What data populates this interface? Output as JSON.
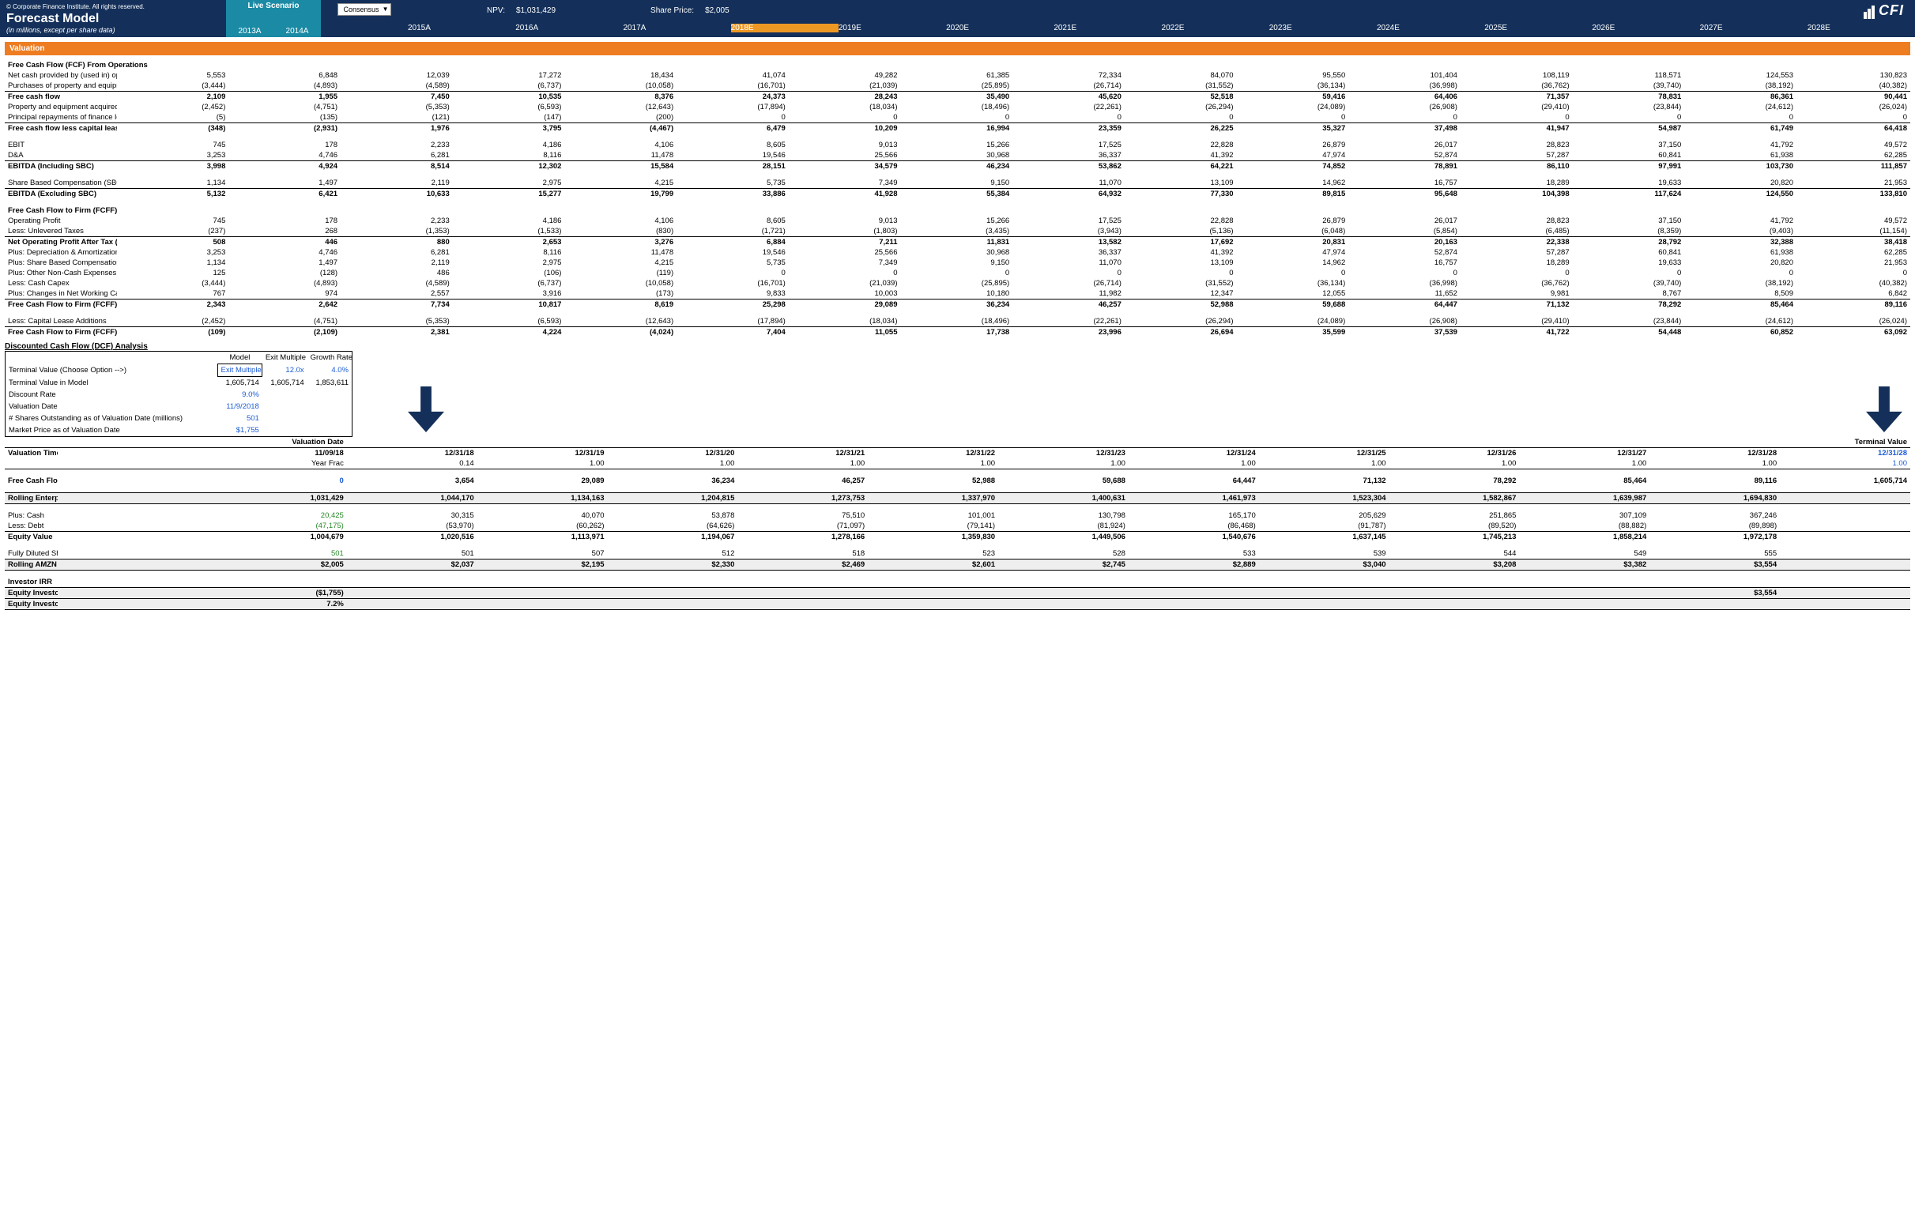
{
  "header": {
    "copyright": "© Corporate Finance Institute. All rights reserved.",
    "title": "Forecast Model",
    "subtitle": "(in millions, except per share data)",
    "scenario_label": "Live Scenario",
    "dropdown": "Consensus",
    "npv_label": "NPV:",
    "npv_value": "$1,031,429",
    "price_label": "Share Price:",
    "price_value": "$2,005",
    "logo": "CFI",
    "years": [
      "2013A",
      "2014A",
      "2015A",
      "2016A",
      "2017A",
      "2018E",
      "2019E",
      "2020E",
      "2021E",
      "2022E",
      "2023E",
      "2024E",
      "2025E",
      "2026E",
      "2027E",
      "2028E"
    ]
  },
  "valuation_bar": "Valuation",
  "fcf_ops": {
    "title": "Free Cash Flow (FCF) From Operations",
    "net_cash": {
      "label": "Net cash provided by (used in) operating activities",
      "v": [
        "5,553",
        "6,848",
        "12,039",
        "17,272",
        "18,434",
        "41,074",
        "49,282",
        "61,385",
        "72,334",
        "84,070",
        "95,550",
        "101,404",
        "108,119",
        "118,571",
        "124,553",
        "130,823"
      ]
    },
    "purchases": {
      "label": "Purchases of property and equipment",
      "v": [
        "(3,444)",
        "(4,893)",
        "(4,589)",
        "(6,737)",
        "(10,058)",
        "(16,701)",
        "(21,039)",
        "(25,895)",
        "(26,714)",
        "(31,552)",
        "(36,134)",
        "(36,998)",
        "(36,762)",
        "(39,740)",
        "(38,192)",
        "(40,382)"
      ]
    },
    "fcf": {
      "label": "Free cash flow",
      "v": [
        "2,109",
        "1,955",
        "7,450",
        "10,535",
        "8,376",
        "24,373",
        "28,243",
        "35,490",
        "45,620",
        "52,518",
        "59,416",
        "64,406",
        "71,357",
        "78,831",
        "86,361",
        "90,441"
      ]
    },
    "ppe_lease": {
      "label": "Property and equipment acquired under capital leases",
      "v": [
        "(2,452)",
        "(4,751)",
        "(5,353)",
        "(6,593)",
        "(12,643)",
        "(17,894)",
        "(18,034)",
        "(18,496)",
        "(22,261)",
        "(26,294)",
        "(24,089)",
        "(26,908)",
        "(29,410)",
        "(23,844)",
        "(24,612)",
        "(26,024)"
      ]
    },
    "principal": {
      "label": "Principal repayments of finance lease obligations",
      "v": [
        "(5)",
        "(135)",
        "(121)",
        "(147)",
        "(200)",
        "0",
        "0",
        "0",
        "0",
        "0",
        "0",
        "0",
        "0",
        "0",
        "0",
        "0"
      ]
    },
    "fcf_less": {
      "label": "Free cash flow less capital leases",
      "v": [
        "(348)",
        "(2,931)",
        "1,976",
        "3,795",
        "(4,467)",
        "6,479",
        "10,209",
        "16,994",
        "23,359",
        "26,225",
        "35,327",
        "37,498",
        "41,947",
        "54,987",
        "61,749",
        "64,418"
      ]
    }
  },
  "ebitda": {
    "ebit": {
      "label": "EBIT",
      "v": [
        "745",
        "178",
        "2,233",
        "4,186",
        "4,106",
        "8,605",
        "9,013",
        "15,266",
        "17,525",
        "22,828",
        "26,879",
        "26,017",
        "28,823",
        "37,150",
        "41,792",
        "49,572"
      ]
    },
    "da": {
      "label": "D&A",
      "v": [
        "3,253",
        "4,746",
        "6,281",
        "8,116",
        "11,478",
        "19,546",
        "25,566",
        "30,968",
        "36,337",
        "41,392",
        "47,974",
        "52,874",
        "57,287",
        "60,841",
        "61,938",
        "62,285"
      ]
    },
    "inc_sbc": {
      "label": "EBITDA (Including SBC)",
      "v": [
        "3,998",
        "4,924",
        "8,514",
        "12,302",
        "15,584",
        "28,151",
        "34,579",
        "46,234",
        "53,862",
        "64,221",
        "74,852",
        "78,891",
        "86,110",
        "97,991",
        "103,730",
        "111,857"
      ]
    },
    "sbc": {
      "label": "Share Based Compensation (SBC)",
      "v": [
        "1,134",
        "1,497",
        "2,119",
        "2,975",
        "4,215",
        "5,735",
        "7,349",
        "9,150",
        "11,070",
        "13,109",
        "14,962",
        "16,757",
        "18,289",
        "19,633",
        "20,820",
        "21,953"
      ]
    },
    "ex_sbc": {
      "label": "EBITDA (Excluding SBC)",
      "v": [
        "5,132",
        "6,421",
        "10,633",
        "15,277",
        "19,799",
        "33,886",
        "41,928",
        "55,384",
        "64,932",
        "77,330",
        "89,815",
        "95,648",
        "104,398",
        "117,624",
        "124,550",
        "133,810"
      ]
    }
  },
  "fcff": {
    "title": "Free Cash Flow to Firm (FCFF)",
    "op_profit": {
      "label": "Operating Profit",
      "v": [
        "745",
        "178",
        "2,233",
        "4,186",
        "4,106",
        "8,605",
        "9,013",
        "15,266",
        "17,525",
        "22,828",
        "26,879",
        "26,017",
        "28,823",
        "37,150",
        "41,792",
        "49,572"
      ]
    },
    "unlev_tax": {
      "label": "  Less: Unlevered Taxes",
      "v": [
        "(237)",
        "268",
        "(1,353)",
        "(1,533)",
        "(830)",
        "(1,721)",
        "(1,803)",
        "(3,435)",
        "(3,943)",
        "(5,136)",
        "(6,048)",
        "(5,854)",
        "(6,485)",
        "(8,359)",
        "(9,403)",
        "(11,154)"
      ]
    },
    "nopat": {
      "label": "Net Operating Profit After Tax (NOPAT)",
      "v": [
        "508",
        "446",
        "880",
        "2,653",
        "3,276",
        "6,884",
        "7,211",
        "11,831",
        "13,582",
        "17,692",
        "20,831",
        "20,163",
        "22,338",
        "28,792",
        "32,388",
        "38,418"
      ]
    },
    "da": {
      "label": "  Plus: Depreciation & Amortization",
      "v": [
        "3,253",
        "4,746",
        "6,281",
        "8,116",
        "11,478",
        "19,546",
        "25,566",
        "30,968",
        "36,337",
        "41,392",
        "47,974",
        "52,874",
        "57,287",
        "60,841",
        "61,938",
        "62,285"
      ]
    },
    "sbc": {
      "label": "  Plus: Share Based Compensation",
      "v": [
        "1,134",
        "1,497",
        "2,119",
        "2,975",
        "4,215",
        "5,735",
        "7,349",
        "9,150",
        "11,070",
        "13,109",
        "14,962",
        "16,757",
        "18,289",
        "19,633",
        "20,820",
        "21,953"
      ]
    },
    "other": {
      "label": "  Plus: Other Non-Cash Expenses",
      "v": [
        "125",
        "(128)",
        "486",
        "(106)",
        "(119)",
        "0",
        "0",
        "0",
        "0",
        "0",
        "0",
        "0",
        "0",
        "0",
        "0",
        "0"
      ]
    },
    "capex": {
      "label": "  Less: Cash Capex",
      "v": [
        "(3,444)",
        "(4,893)",
        "(4,589)",
        "(6,737)",
        "(10,058)",
        "(16,701)",
        "(21,039)",
        "(25,895)",
        "(26,714)",
        "(31,552)",
        "(36,134)",
        "(36,998)",
        "(36,762)",
        "(39,740)",
        "(38,192)",
        "(40,382)"
      ]
    },
    "nwc": {
      "label": "  Plus: Changes in Net Working Capital",
      "v": [
        "767",
        "974",
        "2,557",
        "3,916",
        "(173)",
        "9,833",
        "10,003",
        "10,180",
        "11,982",
        "12,347",
        "12,055",
        "11,652",
        "9,981",
        "8,767",
        "8,509",
        "6,842"
      ]
    },
    "fcff": {
      "label": "Free Cash Flow to Firm (FCFF)",
      "v": [
        "2,343",
        "2,642",
        "7,734",
        "10,817",
        "8,619",
        "25,298",
        "29,089",
        "36,234",
        "46,257",
        "52,988",
        "59,688",
        "64,447",
        "71,132",
        "78,292",
        "85,464",
        "89,116"
      ]
    },
    "cla": {
      "label": "  Less: Capital Lease Additions",
      "v": [
        "(2,452)",
        "(4,751)",
        "(5,353)",
        "(6,593)",
        "(12,643)",
        "(17,894)",
        "(18,034)",
        "(18,496)",
        "(22,261)",
        "(26,294)",
        "(24,089)",
        "(26,908)",
        "(29,410)",
        "(23,844)",
        "(24,612)",
        "(26,024)"
      ]
    },
    "fcff_all": {
      "label": "Free Cash Flow to Firm (FCFF) If All Cash Capex",
      "v": [
        "(109)",
        "(2,109)",
        "2,381",
        "4,224",
        "(4,024)",
        "7,404",
        "11,055",
        "17,738",
        "23,996",
        "26,694",
        "35,599",
        "37,539",
        "41,722",
        "54,448",
        "60,852",
        "63,092"
      ]
    }
  },
  "dcf": {
    "title": "Discounted Cash Flow (DCF) Analysis",
    "hdr": [
      "Model",
      "Exit Multiple",
      "Growth Rate"
    ],
    "tv_choice": {
      "label": "Terminal Value (Choose Option -->)",
      "v": [
        "Exit Multiple",
        "12.0x",
        "4.0%"
      ]
    },
    "tv_model": {
      "label": "Terminal Value in Model",
      "v": [
        "1,605,714",
        "1,605,714",
        "1,853,611"
      ]
    },
    "disc": {
      "label": "Discount Rate",
      "v": "9.0%"
    },
    "date": {
      "label": "Valuation Date",
      "v": "11/9/2018"
    },
    "shares": {
      "label": "# Shares Outstanding as of Valuation Date (millions)",
      "v": "501"
    },
    "price": {
      "label": "Market Price as of Valuation Date",
      "v": "$1,755"
    }
  },
  "timeline": {
    "val_date": "Valuation Date",
    "term_val": "Terminal Value",
    "title": "Valuation Timeline",
    "dates": [
      "11/09/18",
      "12/31/18",
      "12/31/19",
      "12/31/20",
      "12/31/21",
      "12/31/22",
      "12/31/23",
      "12/31/24",
      "12/31/25",
      "12/31/26",
      "12/31/27",
      "12/31/28",
      "12/31/28"
    ],
    "frac_label": "Year Frac",
    "fracs": [
      "0.14",
      "1.00",
      "1.00",
      "1.00",
      "1.00",
      "1.00",
      "1.00",
      "1.00",
      "1.00",
      "1.00",
      "1.00",
      "1.00"
    ],
    "fcff": {
      "label": "Free Cash Flow to Firm (FCFF)",
      "v": [
        "0",
        "3,654",
        "29,089",
        "36,234",
        "46,257",
        "52,988",
        "59,688",
        "64,447",
        "71,132",
        "78,292",
        "85,464",
        "89,116",
        "1,605,714"
      ]
    },
    "ev": {
      "label": "Rolling Enterprise Value (NPV)",
      "v": [
        "1,031,429",
        "1,044,170",
        "1,134,163",
        "1,204,815",
        "1,273,753",
        "1,337,970",
        "1,400,631",
        "1,461,973",
        "1,523,304",
        "1,582,867",
        "1,639,987",
        "1,694,830"
      ]
    },
    "cash": {
      "label": "Plus: Cash",
      "v": [
        "20,425",
        "30,315",
        "40,070",
        "53,878",
        "75,510",
        "101,001",
        "130,798",
        "165,170",
        "205,629",
        "251,865",
        "307,109",
        "367,246"
      ]
    },
    "debt": {
      "label": "Less: Debt",
      "v": [
        "(47,175)",
        "(53,970)",
        "(60,262)",
        "(64,626)",
        "(71,097)",
        "(79,141)",
        "(81,924)",
        "(86,468)",
        "(91,787)",
        "(89,520)",
        "(88,882)",
        "(89,898)"
      ]
    },
    "equity": {
      "label": "Equity Value",
      "v": [
        "1,004,679",
        "1,020,516",
        "1,113,971",
        "1,194,067",
        "1,278,166",
        "1,359,830",
        "1,449,506",
        "1,540,676",
        "1,637,145",
        "1,745,213",
        "1,858,214",
        "1,972,178"
      ]
    },
    "shares": {
      "label": "Fully Diluted Shares Outstanding",
      "v": [
        "501",
        "501",
        "507",
        "512",
        "518",
        "523",
        "528",
        "533",
        "539",
        "544",
        "549",
        "555"
      ]
    },
    "price": {
      "label": "Rolling AMZN Value per Share",
      "v": [
        "$2,005",
        "$2,037",
        "$2,195",
        "$2,330",
        "$2,469",
        "$2,601",
        "$2,745",
        "$2,889",
        "$3,040",
        "$3,208",
        "$3,382",
        "$3,554"
      ]
    }
  },
  "irr": {
    "title": "Investor IRR",
    "ret": {
      "label": "Equity Investor Return (After SBC dilution)",
      "start": "($1,755)",
      "end": "$3,554"
    },
    "irr": {
      "label": "Equity Investor IRR (After SBC dilution)",
      "v": "7.2%"
    }
  }
}
